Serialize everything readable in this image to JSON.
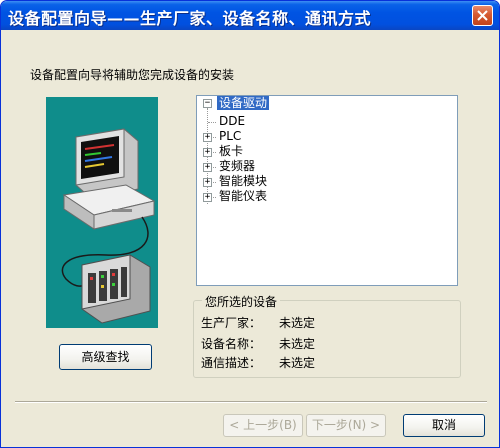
{
  "window": {
    "title": "设备配置向导——生产厂家、设备名称、通讯方式"
  },
  "intro": "设备配置向导将辅助您完成设备的安装",
  "tree": {
    "root": "设备驱动",
    "children": [
      "DDE",
      "PLC",
      "板卡",
      "变频器",
      "智能模块",
      "智能仪表"
    ]
  },
  "selected_device": {
    "group_label": "您所选的设备",
    "rows": [
      {
        "label": "生产厂家：",
        "value": "未选定"
      },
      {
        "label": "设备名称：",
        "value": "未选定"
      },
      {
        "label": "通信描述：",
        "value": "未选定"
      }
    ]
  },
  "buttons": {
    "advanced_search": "高级查找",
    "back": "< 上一步(B)",
    "next": "下一步(N) >",
    "cancel": "取消"
  },
  "colors": {
    "titlebar": "#0054e3",
    "illustration_bg": "#0f8d8b",
    "selection": "#316ac5",
    "window_bg": "#ece9d8"
  }
}
